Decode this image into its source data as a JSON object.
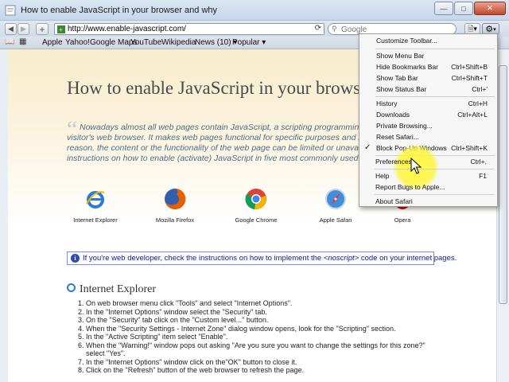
{
  "window": {
    "title": "How to enable JavaScript in your browser and why"
  },
  "toolbar": {
    "url": "http://www.enable-javascript.com/",
    "search_placeholder": "Google",
    "reload_icon": "reload-icon",
    "back_icon": "back-arrow-icon",
    "forward_icon": "forward-arrow-icon",
    "add_icon": "plus-icon",
    "page_icon": "page-menu-icon",
    "gear_icon": "gear-icon"
  },
  "bookmarks": {
    "items": [
      "Apple",
      "Yahoo!",
      "Google Maps",
      "YouTube",
      "Wikipedia",
      "News (10) ▾",
      "Popular ▾"
    ]
  },
  "page": {
    "title": "How to enable JavaScript in your brows",
    "intro": "Nowadays almost all web pages contain JavaScript, a scripting programming la… visitor's web browser. It makes web pages functional for specific purposes and if dis… reason, the content or the functionality of the web page can be limited or unavailab… instructions on how to enable (activate) JavaScript in five most commonly used bro…",
    "intro_lines": [
      "Nowadays almost all web pages contain JavaScript, a scripting programming la",
      "visitor's web browser. It makes web pages functional for specific purposes and if dis",
      "reason, the content or the functionality of the web page can be limited or unavailab",
      "instructions on how to enable (activate) JavaScript in five most commonly used bro"
    ],
    "browsers": [
      {
        "name": "Internet Explorer",
        "color": "#2b7cd3"
      },
      {
        "name": "Mozilla Firefox",
        "color": "#e66000"
      },
      {
        "name": "Google Chrome",
        "color": "#4285f4"
      },
      {
        "name": "Apple Safari",
        "color": "#3d8fe0"
      },
      {
        "name": "Opera",
        "color": "#cc0f16"
      }
    ],
    "notice_before": "If you're web developer, check the instructions on how to implement the ",
    "notice_tag": "<noscript>",
    "notice_after": " code on your internet pages.",
    "section_title": "Internet Explorer",
    "steps": [
      "On web browser menu click \"Tools\" and select \"Internet Options\".",
      "In the \"Internet Options\" window select the \"Security\" tab.",
      "On the \"Security\" tab click on the \"Custom level...\" button.",
      "When the \"Security Settings - Internet Zone\" dialog window opens, look for the \"Scripting\" section.",
      "In the \"Active Scripting\" item select \"Enable\".",
      "When the \"Warning!\" window pops out asking \"Are you sure you want to change the settings for this zone?\"",
      "select \"Yes\".",
      "In the \"Internet Options\" window click on the\"OK\" button to close it.",
      "Click on the \"Refresh\" button of the web browser to refresh the page."
    ],
    "step_numbers": [
      "1.",
      "2.",
      "3.",
      "4.",
      "5.",
      "6.",
      "",
      "7.",
      "8."
    ]
  },
  "menu": {
    "items": [
      {
        "label": "Customize Toolbar...",
        "shortcut": "",
        "checked": false
      },
      {
        "label": "Show Menu Bar",
        "shortcut": "",
        "checked": false
      },
      {
        "label": "Hide Bookmarks Bar",
        "shortcut": "Ctrl+Shift+B",
        "checked": false
      },
      {
        "label": "Show Tab Bar",
        "shortcut": "Ctrl+Shift+T",
        "checked": false
      },
      {
        "label": "Show Status Bar",
        "shortcut": "Ctrl+'",
        "checked": false
      },
      {
        "label": "History",
        "shortcut": "Ctrl+H",
        "checked": false
      },
      {
        "label": "Downloads",
        "shortcut": "Ctrl+Alt+L",
        "checked": false
      },
      {
        "label": "Private Browsing...",
        "shortcut": "",
        "checked": false
      },
      {
        "label": "Reset Safari...",
        "shortcut": "",
        "checked": false
      },
      {
        "label": "Block Pop-Up Windows",
        "shortcut": "Ctrl+Shift+K",
        "checked": true
      },
      {
        "label": "Preferences...",
        "shortcut": "Ctrl+,",
        "checked": false
      },
      {
        "label": "Help",
        "shortcut": "F1",
        "checked": false
      },
      {
        "label": "Report Bugs to Apple...",
        "shortcut": "",
        "checked": false
      },
      {
        "label": "About Safari",
        "shortcut": "",
        "checked": false
      }
    ],
    "check_mark": "✓",
    "highlight_color": "#fff23a"
  }
}
